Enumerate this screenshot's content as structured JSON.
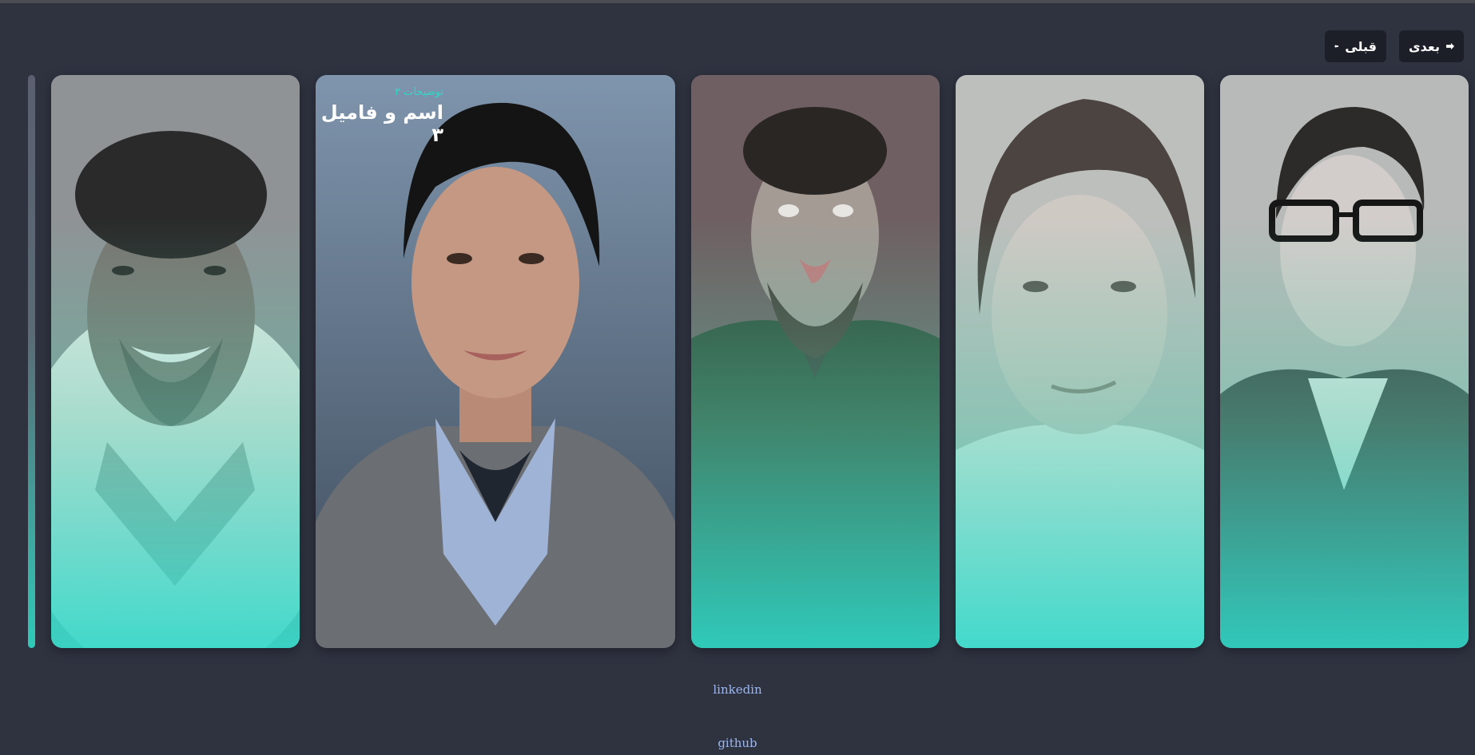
{
  "nav": {
    "prev_label": "قبلی",
    "next_label": "بعدی"
  },
  "featured": {
    "description": "توضیحات ۳",
    "name": "اسم و فامیل ۳"
  },
  "links": {
    "linkedin": "linkedin",
    "github": "github"
  },
  "colors": {
    "background": "#2f3340",
    "button_bg": "#1c1f27",
    "accent_teal": "#2fd7c8",
    "link": "#9bb7f2"
  }
}
